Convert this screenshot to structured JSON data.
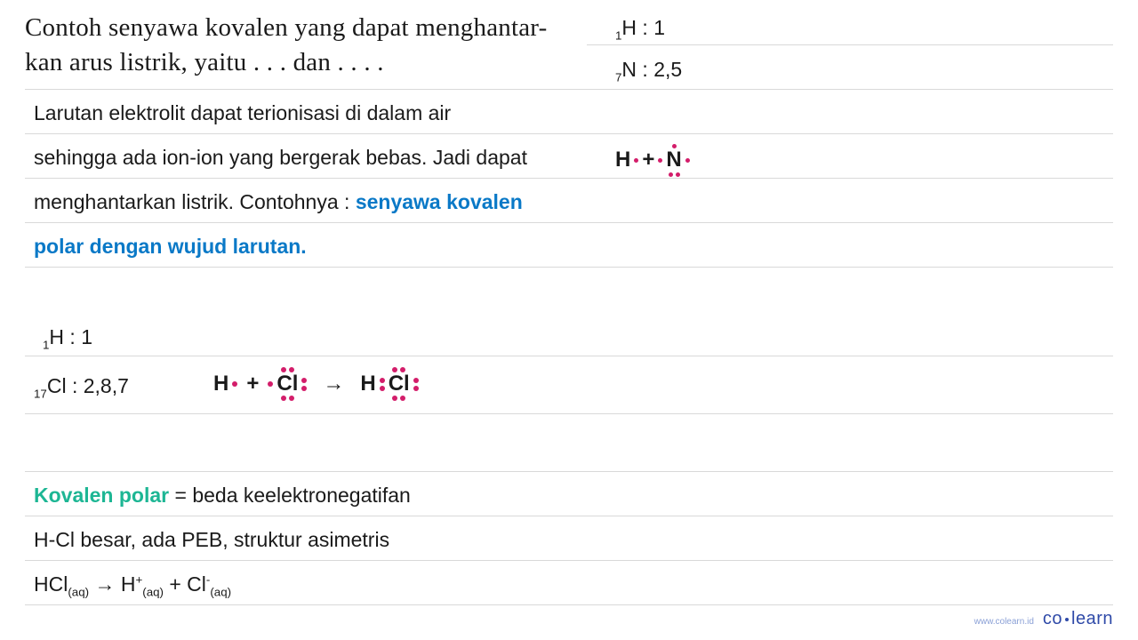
{
  "question": {
    "line1": "Contoh senyawa kovalen yang dapat menghantar-",
    "line2": "kan arus listrik, yaitu . . . dan . . . ."
  },
  "top_right": {
    "h_label": "H",
    "h_sub": "1",
    "h_val": " : 1",
    "n_label": "N",
    "n_sub": "7",
    "n_val": " : 2,5"
  },
  "explain": {
    "l1": "Larutan elektrolit dapat terionisasi di dalam air",
    "l2": "sehingga ada ion-ion yang bergerak bebas. Jadi dapat",
    "l3a": "menghantarkan listrik. Contohnya : ",
    "l3b": "senyawa kovalen",
    "l4": "polar dengan wujud larutan."
  },
  "mid_lewis": {
    "H": "H",
    "plus": " + ",
    "N": "N"
  },
  "config": {
    "h_sub": "1",
    "h": "H  : 1",
    "cl_sub": "17",
    "cl": "Cl  : 2,8,7"
  },
  "lewis_line": {
    "H": "H",
    "plus": " + ",
    "Cl": "Cl",
    "arrow": "→",
    "H2": "H",
    "Cl2": "Cl"
  },
  "bottom": {
    "kp": "Kovalen polar",
    "kp_rest": " = beda keelektronegatifan",
    "l2": "H-Cl besar, ada PEB, struktur asimetris",
    "eq_a": "HCl",
    "eq_aq": "(aq)",
    "eq_arrow": " → ",
    "eq_b": "H",
    "eq_b_sup": "+",
    "eq_plus": " + ",
    "eq_c": "Cl",
    "eq_c_sup": "-"
  },
  "footer": {
    "url": "www.colearn.id",
    "brand_a": "co",
    "brand_b": "learn"
  }
}
